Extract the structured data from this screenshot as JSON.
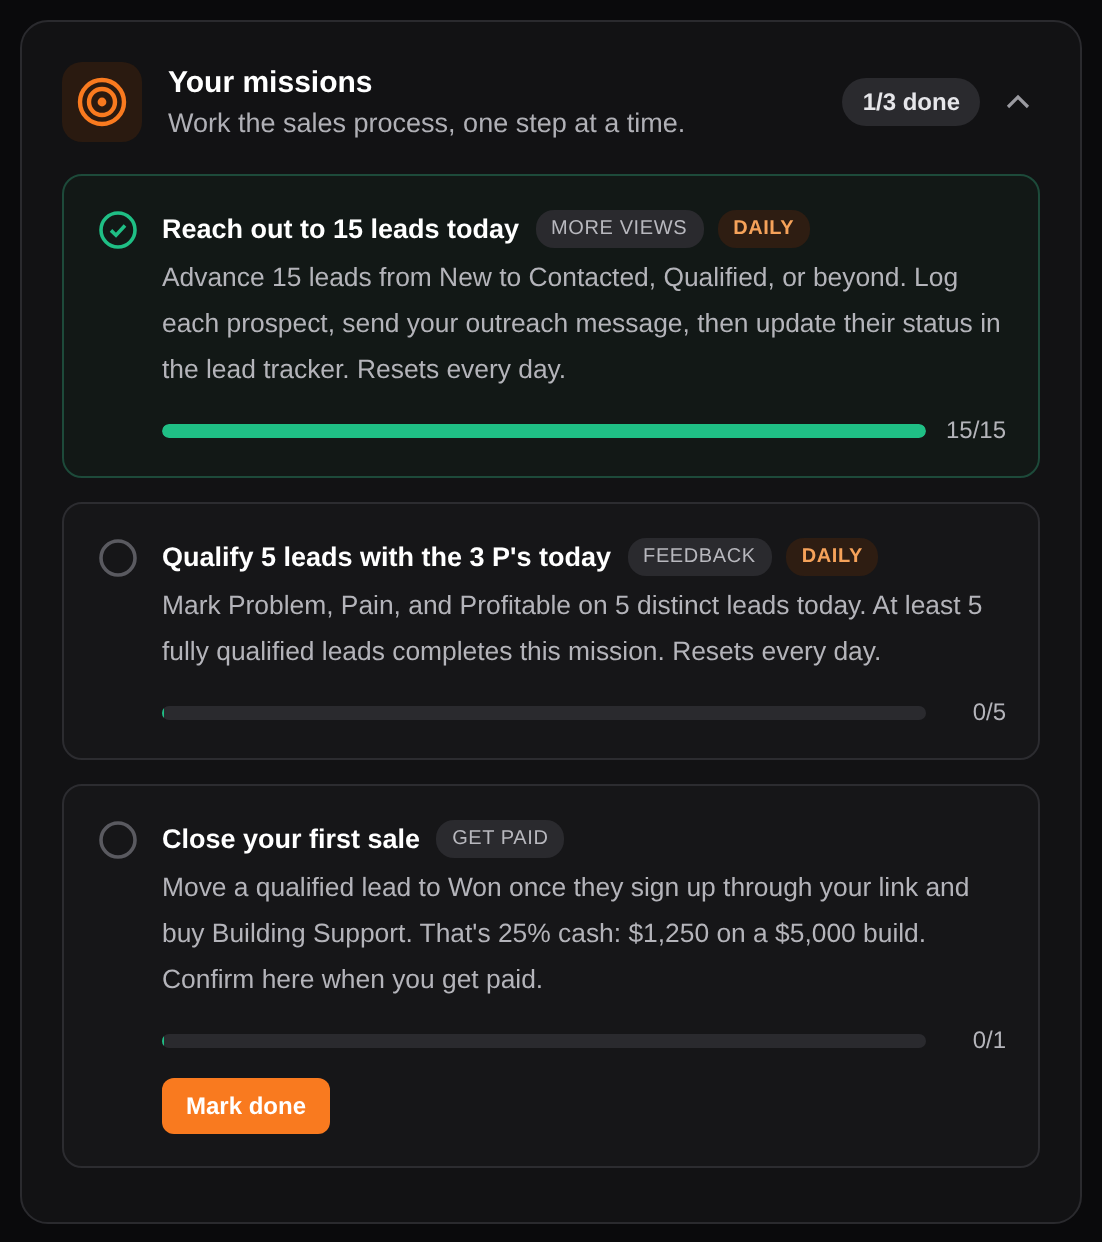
{
  "header": {
    "title": "Your missions",
    "subtitle": "Work the sales process, one step at a time.",
    "status": "1/3 done",
    "expanded": true
  },
  "missions": [
    {
      "title": "Reach out to 15 leads today",
      "done": true,
      "tags": [
        {
          "label": "MORE VIEWS",
          "kind": "neutral"
        },
        {
          "label": "DAILY",
          "kind": "daily"
        }
      ],
      "description": "Advance 15 leads from New to Contacted, Qualified, or beyond. Log each prospect, send your outreach message, then update their status in the lead tracker. Resets every day.",
      "level": 1,
      "progress": "15/15"
    },
    {
      "title": "Qualify 5 leads with the 3 P's today",
      "done": false,
      "tags": [
        {
          "label": "FEEDBACK",
          "kind": "neutral"
        },
        {
          "label": "DAILY",
          "kind": "daily"
        }
      ],
      "description": "Mark Problem, Pain, and Profitable on 5 distinct leads today. At least 5 fully qualified leads completes this mission. Resets every day.",
      "level": 0,
      "progress": "0/5"
    },
    {
      "title": "Close your first sale",
      "done": false,
      "tags": [
        {
          "label": "GET PAID",
          "kind": "neutral"
        }
      ],
      "description": "Move a qualified lead to Won once they sign up through your link and buy Building Support. That's 25% cash: $1,250 on a $5,000 build. Confirm here when you get paid.",
      "level": 0,
      "progress": "0/1",
      "button": "Mark done"
    }
  ]
}
